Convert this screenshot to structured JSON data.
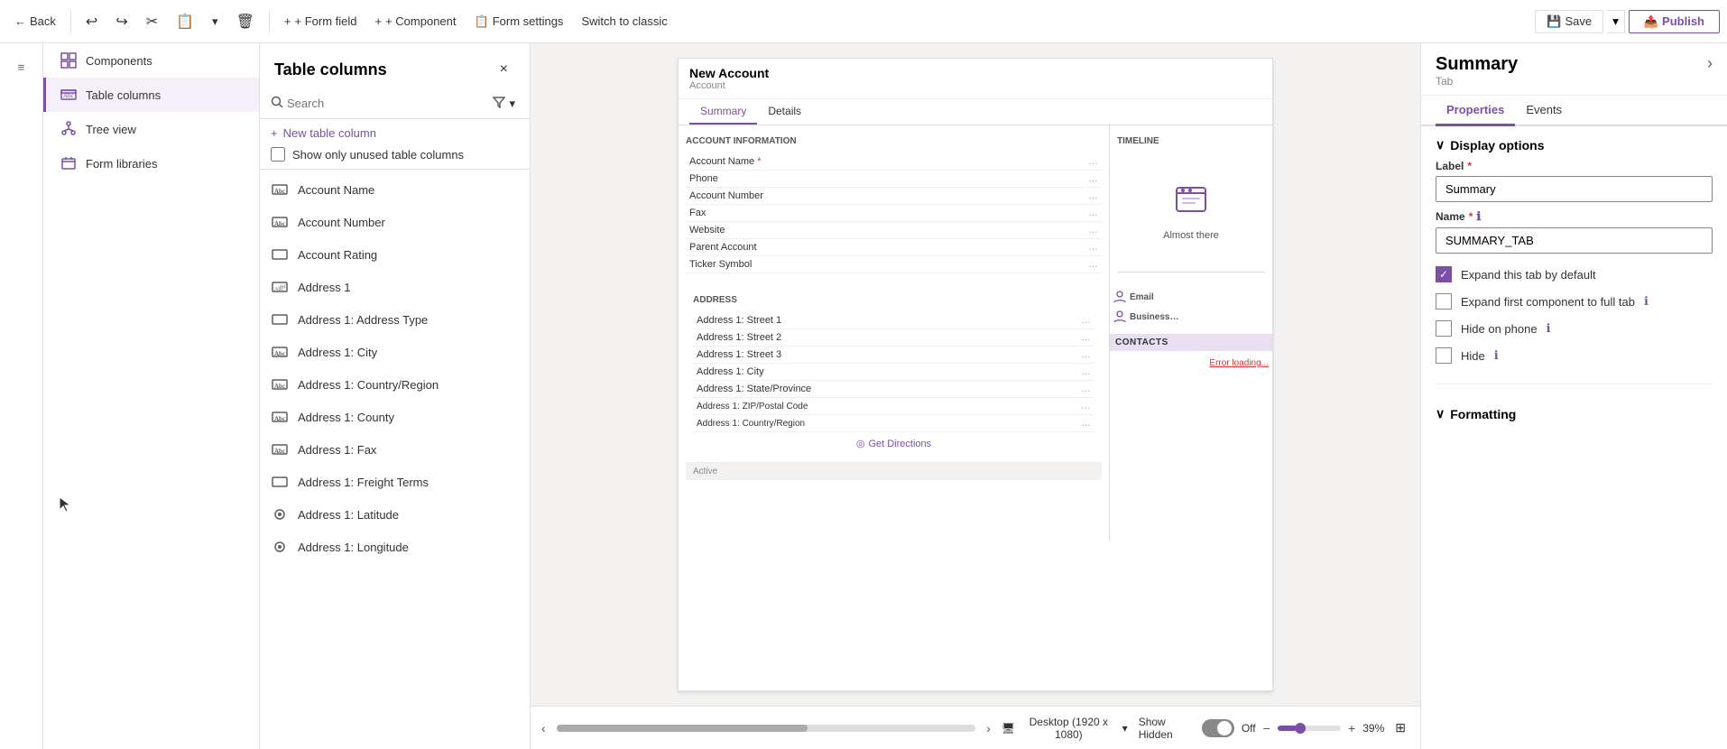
{
  "toolbar": {
    "back_label": "Back",
    "form_field_label": "+ Form field",
    "component_label": "+ Component",
    "form_settings_label": "Form settings",
    "switch_classic_label": "Switch to classic",
    "save_label": "Save",
    "publish_label": "Publish"
  },
  "left_sidebar": {
    "menu_icon": "≡"
  },
  "nav_panel": {
    "items": [
      {
        "id": "components",
        "label": "Components",
        "icon": "⊞"
      },
      {
        "id": "table-columns",
        "label": "Table columns",
        "icon": "Abc",
        "active": true
      },
      {
        "id": "tree-view",
        "label": "Tree view",
        "icon": "🌲"
      },
      {
        "id": "form-libraries",
        "label": "Form libraries",
        "icon": "📚"
      }
    ]
  },
  "columns_panel": {
    "title": "Table columns",
    "search_placeholder": "Search",
    "new_column_label": "New table column",
    "show_unused_label": "Show only unused table columns",
    "items": [
      {
        "label": "Account Name",
        "icon": "Abc"
      },
      {
        "label": "Account Number",
        "icon": "Abc"
      },
      {
        "label": "Account Rating",
        "icon": "□"
      },
      {
        "label": "Address 1",
        "icon": "Abc"
      },
      {
        "label": "Address 1: Address Type",
        "icon": "□"
      },
      {
        "label": "Address 1: City",
        "icon": "Abc"
      },
      {
        "label": "Address 1: Country/Region",
        "icon": "Abc"
      },
      {
        "label": "Address 1: County",
        "icon": "Abc"
      },
      {
        "label": "Address 1: Fax",
        "icon": "Abc"
      },
      {
        "label": "Address 1: Freight Terms",
        "icon": "□"
      },
      {
        "label": "Address 1: Latitude",
        "icon": "◉"
      },
      {
        "label": "Address 1: Longitude",
        "icon": "◉"
      }
    ]
  },
  "form_preview": {
    "title": "New Account",
    "subtitle": "Account",
    "tabs": [
      {
        "label": "Summary",
        "active": true
      },
      {
        "label": "Details",
        "active": false
      }
    ],
    "account_info_section": "ACCOUNT INFORMATION",
    "account_rows": [
      {
        "label": "Account Name",
        "required": true
      },
      {
        "label": "Phone"
      },
      {
        "label": "Account Number"
      },
      {
        "label": "Fax"
      },
      {
        "label": "Website"
      },
      {
        "label": "Parent Account"
      },
      {
        "label": "Ticker Symbol"
      }
    ],
    "timeline_title": "Timeline",
    "timeline_almost_there": "Almost there",
    "address_section": "ADDRESS",
    "address_rows": [
      {
        "label": "Address 1: Street 1"
      },
      {
        "label": "Address 1: Street 2"
      },
      {
        "label": "Address 1: Street 3"
      },
      {
        "label": "Address 1: City"
      },
      {
        "label": "Address 1: State/Province"
      },
      {
        "label": "Address 1: ZIP/Postal Code"
      },
      {
        "label": "Address 1: Country/Region"
      }
    ],
    "get_directions": "Get Directions",
    "active_label": "Active",
    "error_label": "Error loading...",
    "contacts_label": "CONTACTS"
  },
  "bottom_bar": {
    "desktop_label": "Desktop (1920 x 1080)",
    "show_hidden_label": "Show Hidden",
    "toggle_state": "Off",
    "zoom_minus": "−",
    "zoom_plus": "+",
    "zoom_level": "39%"
  },
  "right_panel": {
    "title": "Summary",
    "subtitle": "Tab",
    "tabs": [
      {
        "label": "Properties",
        "active": true
      },
      {
        "label": "Events",
        "active": false
      }
    ],
    "display_options": {
      "section_label": "Display options",
      "label_field": {
        "label": "Label",
        "value": "Summary"
      },
      "name_field": {
        "label": "Name",
        "value": "SUMMARY_TAB"
      },
      "checkboxes": [
        {
          "id": "expand-tab",
          "label": "Expand this tab by default",
          "checked": true,
          "has_info": false
        },
        {
          "id": "expand-first",
          "label": "Expand first component to full tab",
          "checked": false,
          "has_info": true
        },
        {
          "id": "hide-phone",
          "label": "Hide on phone",
          "checked": false,
          "has_info": true
        },
        {
          "id": "hide",
          "label": "Hide",
          "checked": false,
          "has_info": true
        }
      ]
    },
    "formatting": {
      "section_label": "Formatting"
    }
  },
  "icons": {
    "back_arrow": "←",
    "undo": "↩",
    "redo": "↪",
    "cut": "✂",
    "paste": "📋",
    "dropdown": "▾",
    "delete": "🗑",
    "save_icon": "💾",
    "publish_icon": "📤",
    "close": "×",
    "search": "🔍",
    "filter": "⊘",
    "chevron_down": "▾",
    "chevron_left": "‹",
    "chevron_right": "›",
    "plus": "+",
    "info": "ℹ",
    "chevron_up": "▲",
    "expand_collapse": "∨",
    "gear": "⚙",
    "monitor": "🖥",
    "compass": "◎",
    "pin": "📌"
  }
}
